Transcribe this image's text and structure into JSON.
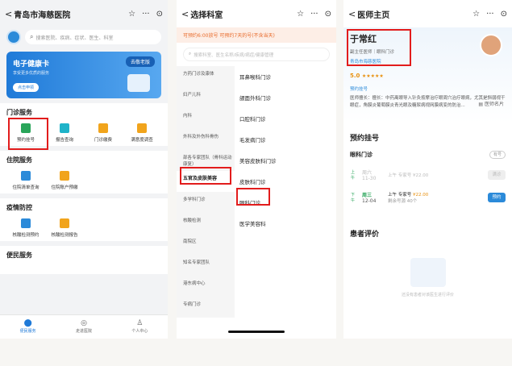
{
  "s1": {
    "title": "青岛市海慈医院",
    "search_placeholder": "搜索医院、疾病、症状、医生、科室",
    "card": {
      "title": "电子健康卡",
      "subtitle": "享受更多优质的服务",
      "btn": "点击申领",
      "old": "去敬老版"
    },
    "sections": [
      {
        "title": "门诊服务",
        "items": [
          {
            "label": "预约挂号",
            "icon_color": "#2aa55a"
          },
          {
            "label": "报告查询",
            "icon_color": "#1fb3c9"
          },
          {
            "label": "门诊缴费",
            "icon_color": "#f1a41c"
          },
          {
            "label": "满意度调查",
            "icon_color": "#f1a41c"
          }
        ]
      },
      {
        "title": "住院服务",
        "items": [
          {
            "label": "住院清单查询",
            "icon_color": "#2b8ad9"
          },
          {
            "label": "住院账户预缴",
            "icon_color": "#f1a41c"
          }
        ]
      },
      {
        "title": "疫情防控",
        "items": [
          {
            "label": "核酸检测预约",
            "icon_color": "#2b8ad9"
          },
          {
            "label": "核酸检测报告",
            "icon_color": "#f1a41c"
          }
        ]
      },
      {
        "title": "便民服务",
        "items": []
      }
    ],
    "tabs": [
      {
        "label": "便民服务",
        "icon": "home-icon"
      },
      {
        "label": "走进医院",
        "icon": "compass-icon"
      },
      {
        "label": "个人中心",
        "icon": "user-icon"
      }
    ]
  },
  "s2": {
    "title": "选择科室",
    "notice": "可预约6:00放号 可预约7天的号(不含当天)",
    "search_placeholder": "搜索科室、医生名称/疾病/病症/健康管理",
    "left": [
      "方药门诊及康体",
      "妇产儿科",
      "内科",
      "外科及外伤科骨伤",
      "部各专家团队（骨科运动康复）",
      "五官及皮肤美容",
      "多学科门诊",
      "核酸检测",
      "南院区",
      "知名专家团队",
      "港东病中心",
      "专病门诊"
    ],
    "right": [
      "耳鼻喉科门诊",
      "颌面外科门诊",
      "口腔科门诊",
      "毛发病门诊",
      "美容皮肤科门诊",
      "皮肤科门诊",
      "眼科门诊",
      "医学美容科"
    ]
  },
  "s3": {
    "title": "医师主页",
    "name": "于常红",
    "role": "副主任医师｜眼科门诊",
    "hospital": "青岛市海慈医院",
    "rating": "5.0",
    "stars": "★★★★★",
    "card_link": "医师名片",
    "spec_title": "预约挂号",
    "spec": "医师擅长：擅长：中药离眼导入针灸按摩治疗眼周穴治疗眼病，尤其是斜弱视干眼症，角膜炎葡萄膜炎青光眼及糖尿病视网膜病变的防治...",
    "section": "预约挂号",
    "dept": "眼科门诊",
    "dept_status": "有号",
    "slots": [
      {
        "tag": "上午",
        "day": "周六",
        "date": "11-30",
        "desc": "上午 专家号",
        "price": "¥22.00",
        "btn": "满诊"
      },
      {
        "tag": "下午",
        "day": "周三",
        "date": "12-04",
        "desc": "上午 专家号",
        "price": "¥22.00",
        "extra": "剩余号源 40个",
        "btn": "预约"
      }
    ],
    "reviews": "患者评价",
    "empty": "还没有患者对该医生进行评价"
  }
}
